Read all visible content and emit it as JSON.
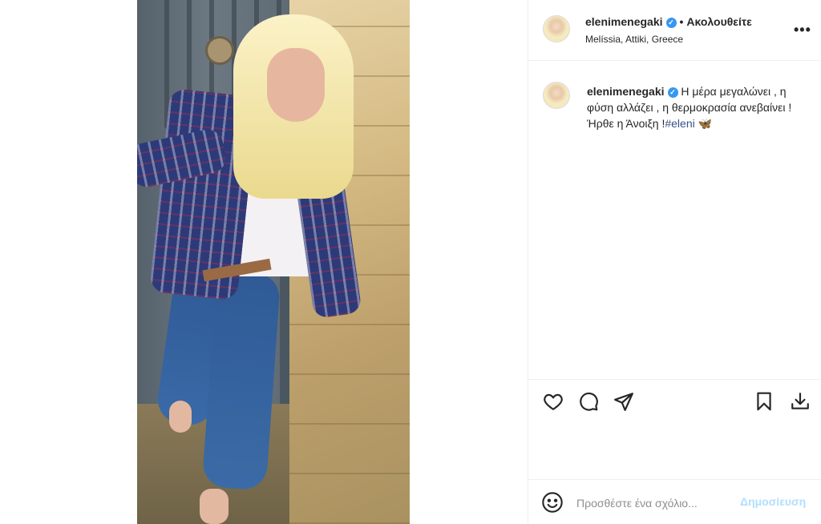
{
  "post": {
    "author": {
      "username": "elenimenegaki",
      "verified": true,
      "follow_label": "Ακολουθείτε",
      "location": "Melíssia, Attiki, Greece"
    },
    "more_label": "•••",
    "caption": {
      "username": "elenimenegaki",
      "text": "Η μέρα μεγαλώνει , η φύση αλλάζει , η θερμοκρασία ανεβαίνει ! Ήρθε η Άνοιξη !",
      "hashtag": "#eleni",
      "emoji": "🦋"
    },
    "actions": {
      "like": "heart-icon",
      "comment": "comment-icon",
      "share": "share-icon",
      "save": "bookmark-icon",
      "download": "download-icon"
    },
    "comment_box": {
      "placeholder": "Προσθέστε ένα σχόλιο...",
      "post_label": "Δημοσίευση"
    }
  },
  "colors": {
    "text": "#262626",
    "verified": "#3897f0",
    "hashtag": "#385185",
    "post_disabled": "#b2dffc",
    "border": "#efefef"
  }
}
